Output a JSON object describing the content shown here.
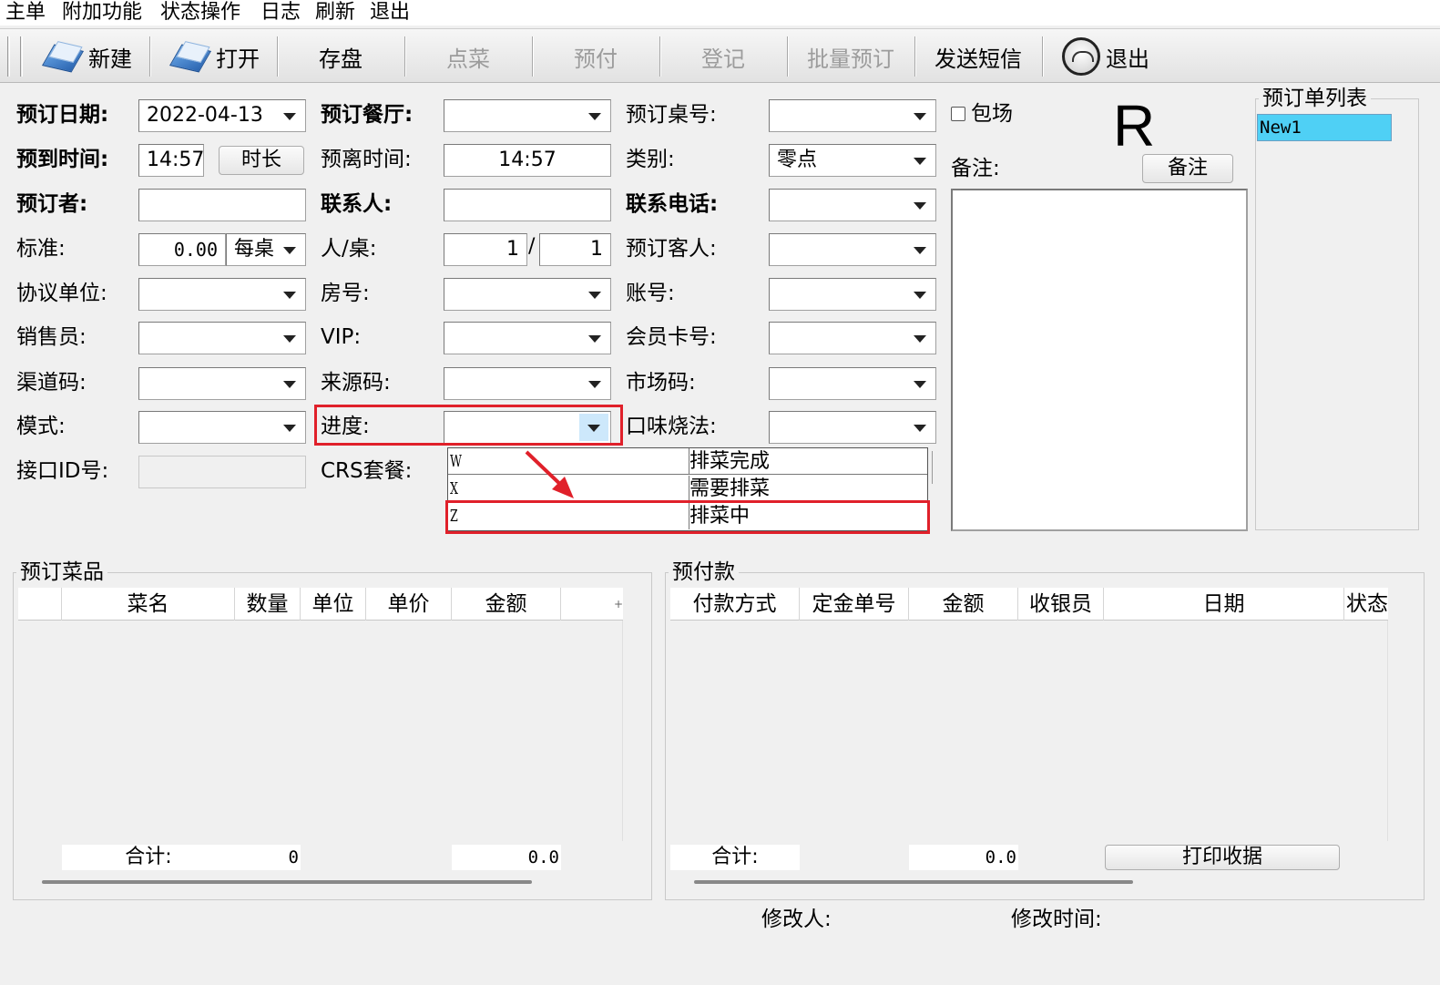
{
  "menu": [
    "主单",
    "附加功能",
    "状态操作",
    "日志",
    "刷新",
    "退出"
  ],
  "toolbar": {
    "new": "新建",
    "open": "打开",
    "save": "存盘",
    "order": "点菜",
    "prepay": "预付",
    "register": "登记",
    "batch": "批量预订",
    "sms": "发送短信",
    "exit": "退出"
  },
  "form": {
    "date_label": "预订日期:",
    "date_value": "2022-04-13",
    "restaurant_label": "预订餐厅:",
    "restaurant_value": "",
    "table_label": "预订桌号:",
    "table_value": "",
    "whole_venue_label": "包场",
    "arrive_label": "预到时间:",
    "arrive_value": "14:57",
    "duration_btn": "时长",
    "leave_label": "预离时间:",
    "leave_value": "14:57",
    "category_label": "类别:",
    "category_value": "零点",
    "booker_label": "预订者:",
    "booker_value": "",
    "contact_label": "联系人:",
    "contact_value": "",
    "phone_label": "联系电话:",
    "phone_value": "",
    "standard_label": "标准:",
    "standard_value": "0.00",
    "standard_unit": "每桌",
    "people_label": "人/桌:",
    "people_value": "1",
    "tables_value": "1",
    "guest_label": "预订客人:",
    "guest_value": "",
    "agreement_label": "协议单位:",
    "room_label": "房号:",
    "account_label": "账号:",
    "sales_label": "销售员:",
    "vip_label": "VIP:",
    "member_label": "会员卡号:",
    "channel_label": "渠道码:",
    "source_label": "来源码:",
    "market_label": "市场码:",
    "mode_label": "模式:",
    "progress_label": "进度:",
    "taste_label": "口味烧法:",
    "interface_label": "接口ID号:",
    "crs_label": "CRS套餐:",
    "remark_label": "备注:",
    "remark_btn": "备注",
    "big_letter": "R"
  },
  "progress_options": [
    {
      "code": "W",
      "text": "排菜完成"
    },
    {
      "code": "X",
      "text": "需要排菜"
    },
    {
      "code": "Z",
      "text": "排菜中"
    }
  ],
  "order_list": {
    "title": "预订单列表",
    "items": [
      "New1"
    ]
  },
  "dishes": {
    "title": "预订菜品",
    "columns": [
      "",
      "菜名",
      "数量",
      "单位",
      "单价",
      "金额",
      "+"
    ],
    "total_label": "合计:",
    "total_count": "0",
    "total_amount": "0.0"
  },
  "prepay": {
    "title": "预付款",
    "columns": [
      "付款方式",
      "定金单号",
      "金额",
      "收银员",
      "日期",
      "状态"
    ],
    "total_label": "合计:",
    "total_amount": "0.0",
    "print_btn": "打印收据"
  },
  "footer": {
    "modifier_label": "修改人:",
    "modify_time_label": "修改时间:"
  },
  "colors": {
    "highlight_red": "#e0202a",
    "selected_item": "#4fd0f5"
  }
}
